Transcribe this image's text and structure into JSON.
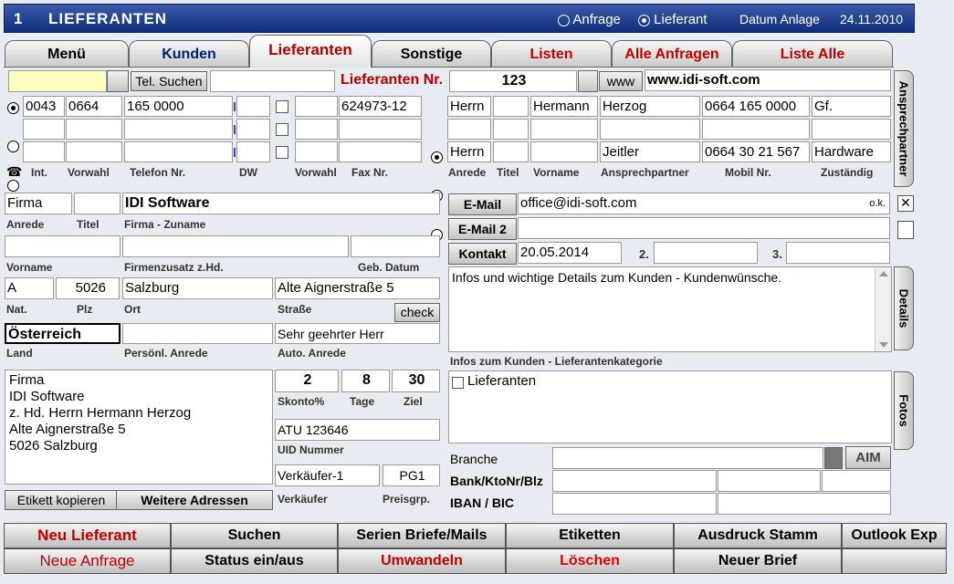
{
  "window": {
    "number": "1",
    "title": "LIEFERANTEN",
    "mode_anfrage": "Anfrage",
    "mode_lieferant": "Lieferant",
    "datum_label": "Datum Anlage",
    "datum_value": "24.11.2010"
  },
  "tabs": [
    "Menü",
    "Kunden",
    "Lieferanten",
    "Sonstige",
    "Listen",
    "Alle Anfragen",
    "Liste Alle"
  ],
  "search": {
    "tel_button": "Tel. Suchen",
    "lieferanten_nr_label": "Lieferanten Nr.",
    "lieferanten_nr": "123",
    "www_button": "www",
    "website": "www.idi-soft.com"
  },
  "phones": [
    {
      "int": "0043",
      "vorwahl": "0664",
      "telefon": "165 0000",
      "dw": "",
      "fax_vorwahl": "",
      "fax": "624973-12"
    },
    {
      "int": "",
      "vorwahl": "",
      "telefon": "",
      "dw": "",
      "fax_vorwahl": "",
      "fax": ""
    },
    {
      "int": "",
      "vorwahl": "",
      "telefon": "",
      "dw": "",
      "fax_vorwahl": "",
      "fax": ""
    }
  ],
  "phone_labels": {
    "int": "Int.",
    "vorwahl": "Vorwahl",
    "telefon": "Telefon Nr.",
    "dw": "DW",
    "fax_vorwahl": "Vorwahl",
    "fax": "Fax Nr."
  },
  "contacts": [
    {
      "anrede": "Herrn",
      "titel": "",
      "vorname": "Hermann",
      "name": "Herzog",
      "mobil": "0664 165 0000",
      "zustaendig": "Gf."
    },
    {
      "anrede": "",
      "titel": "",
      "vorname": "",
      "name": "",
      "mobil": "",
      "zustaendig": ""
    },
    {
      "anrede": "Herrn",
      "titel": "",
      "vorname": "",
      "name": "Jeitler",
      "mobil": "0664 30 21 567",
      "zustaendig": "Hardware"
    }
  ],
  "contact_labels": {
    "anrede": "Anrede",
    "titel": "Titel",
    "vorname": "Vorname",
    "name": "Ansprechpartner",
    "mobil": "Mobil Nr.",
    "zustaendig": "Zuständig"
  },
  "side_tabs": {
    "ansprechpartner": "Ansprechpartner",
    "details": "Details",
    "fotos": "Fotos"
  },
  "company": {
    "anrede": "Firma",
    "titel": "",
    "name": "IDI Software",
    "vorname": "",
    "zusatz": "",
    "geb_datum": "",
    "nat": "A",
    "plz": "5026",
    "ort": "Salzburg",
    "strasse": "Alte Aignerstraße 5",
    "land": "Österreich",
    "pers_anrede": "",
    "auto_anrede": "Sehr geehrter Herr"
  },
  "company_labels": {
    "anrede": "Anrede",
    "titel": "Titel",
    "name": "Firma - Zuname",
    "vorname": "Vorname",
    "zusatz": "Firmenzusatz z.Hd.",
    "geb_datum": "Geb. Datum",
    "nat": "Nat.",
    "plz": "Plz",
    "ort": "Ort",
    "strasse": "Straße",
    "check": "check",
    "land": "Land",
    "pers_anrede": "Persönl. Anrede",
    "auto_anrede": "Auto.  Anrede"
  },
  "address_block": [
    "Firma",
    "IDI Software",
    "z. Hd. Herrn Hermann Herzog",
    "Alte Aignerstraße 5",
    "5026 Salzburg"
  ],
  "address_buttons": {
    "copy": "Etikett kopieren",
    "more": "Weitere Adressen"
  },
  "terms": {
    "skonto": "2",
    "tage": "8",
    "ziel": "30",
    "skonto_label": "Skonto%",
    "tage_label": "Tage",
    "ziel_label": "Ziel",
    "uid": "ATU 123646",
    "uid_label": "UID Nummer",
    "verkaeufer": "Verkäufer-1",
    "preisgrp": "PG1",
    "verkaeufer_label": "Verkäufer",
    "preisgrp_label": "Preisgrp."
  },
  "email": {
    "label1": "E-Mail",
    "value1": "office@idi-soft.com",
    "ok": "o.k.",
    "label2": "E-Mail 2",
    "value2": "",
    "kontakt_label": "Kontakt",
    "kontakt1": "20.05.2014",
    "n2": "2.",
    "kontakt2": "",
    "n3": "3.",
    "kontakt3": ""
  },
  "info": {
    "text": "Infos und wichtige Details zum Kunden - Kundenwünsche.",
    "kategorie_label": "Infos zum Kunden - Lieferantenkategorie",
    "kategorie_item": "Lieferanten"
  },
  "bank": {
    "branche_label": "Branche",
    "branche_value": "",
    "aim": "AIM",
    "bank_label": "Bank/KtoNr/Blz",
    "iban_label": "IBAN / BIC"
  },
  "bottom_row1": [
    "Neu Lieferant",
    "Suchen",
    "Serien Briefe/Mails",
    "Etiketten",
    "Ausdruck Stamm",
    "Outlook Exp"
  ],
  "bottom_row2": [
    "Neue Anfrage",
    "Status ein/aus",
    "Umwandeln",
    "Löschen",
    "Neuer Brief",
    ""
  ]
}
